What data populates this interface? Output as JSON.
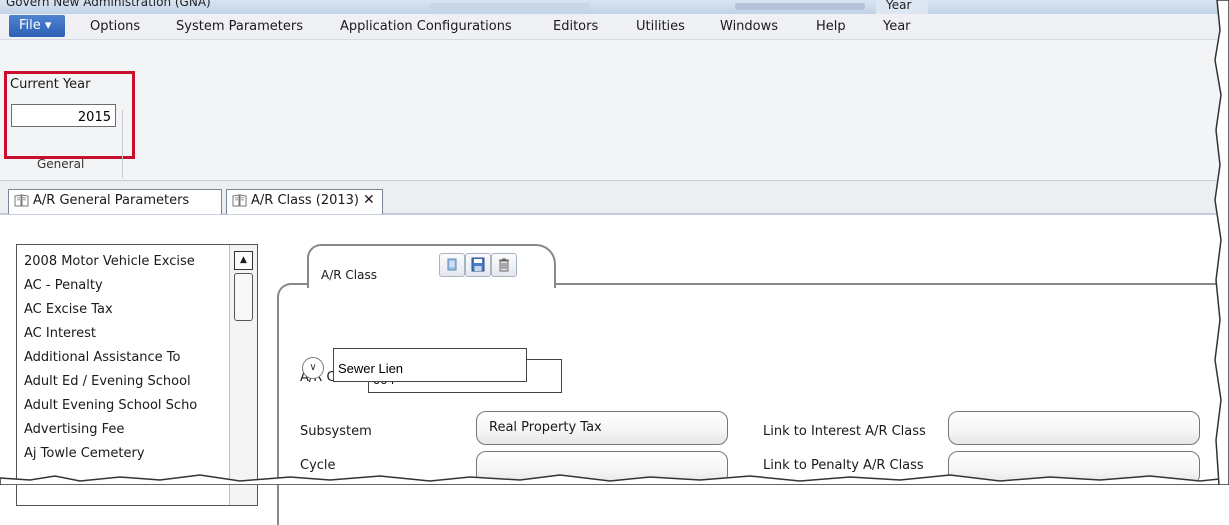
{
  "window": {
    "title": "Govern New Administration (GNA)",
    "context_tab": "Year"
  },
  "menu": {
    "file_label": "File ▾",
    "items": [
      "Options",
      "System Parameters",
      "Application Configurations",
      "Editors",
      "Utilities",
      "Windows",
      "Help",
      "Year"
    ]
  },
  "ribbon": {
    "current_year_label": "Current Year",
    "current_year_value": "2015",
    "group_label": "General"
  },
  "doc_tabs": [
    {
      "label": "A/R General Parameters"
    },
    {
      "label": "A/R Class (2013)",
      "close": "✕"
    }
  ],
  "class_list": [
    "2008 Motor Vehicle Excise",
    "AC - Penalty",
    "AC Excise Tax",
    "AC Interest",
    "Additional Assistance To",
    "Adult Ed / Evening School",
    "Adult Evening School Scho",
    "Advertising Fee",
    "Aj Towle Cemetery"
  ],
  "form": {
    "tab_label": "A/R Class",
    "ar_class_label": "A/R Class",
    "ar_class_value": "004",
    "description_value": "Sewer Lien",
    "subsystem_label": "Subsystem",
    "subsystem_value": "Real Property Tax",
    "cycle_label": "Cycle",
    "cycle_value": "",
    "link_interest_label": "Link to Interest A/R Class",
    "link_interest_value": "",
    "link_penalty_label": "Link to Penalty A/R Class",
    "link_penalty_value": ""
  },
  "colors": {
    "highlight": "#c8102e",
    "file_button": "#3a6fc4"
  }
}
